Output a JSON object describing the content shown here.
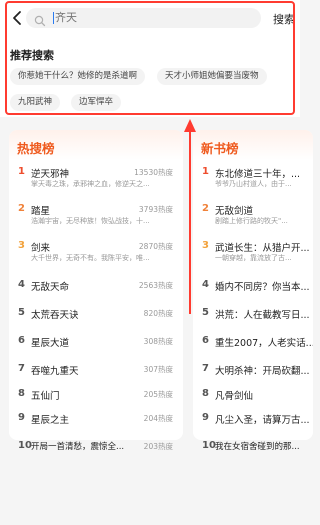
{
  "search": {
    "placeholder": "齐天",
    "search_button": "搜索"
  },
  "recommend": {
    "title": "推荐搜索",
    "tags": [
      "你惹她干什么？她修的是杀道啊",
      "天才小师姐她偏要当废物",
      "九阳武神",
      "边军悍卒"
    ]
  },
  "hot_list": {
    "title": "热搜榜",
    "items": [
      {
        "rank": "1",
        "title": "逆天邪神",
        "metric": "13530热度",
        "sub": "掌天毒之珠，承邪神之血，修逆天之..."
      },
      {
        "rank": "2",
        "title": "踏星",
        "metric": "3793热度",
        "sub": "浩瀚宇宙，无尽种族！恢弘战技，十..."
      },
      {
        "rank": "3",
        "title": "剑来",
        "metric": "2870热度",
        "sub": "大千世界，无奇不有。我陈平安，唯..."
      },
      {
        "rank": "4",
        "title": "无敌天命",
        "metric": "2563热度",
        "sub": ""
      },
      {
        "rank": "5",
        "title": "太荒吞天诀",
        "metric": "820热度",
        "sub": ""
      },
      {
        "rank": "6",
        "title": "星辰大道",
        "metric": "308热度",
        "sub": ""
      },
      {
        "rank": "7",
        "title": "吞噬九重天",
        "metric": "307热度",
        "sub": ""
      },
      {
        "rank": "8",
        "title": "五仙门",
        "metric": "205热度",
        "sub": ""
      },
      {
        "rank": "9",
        "title": "星辰之主",
        "metric": "204热度",
        "sub": ""
      },
      {
        "rank": "10",
        "title": "开局一首清愁，震惊全...",
        "metric": "203热度",
        "sub": ""
      }
    ]
  },
  "new_list": {
    "title": "新书榜",
    "items": [
      {
        "rank": "1",
        "title": "东北修道三十年，...",
        "sub": "爷爷乃山村道人，由于..."
      },
      {
        "rank": "2",
        "title": "无敌剑道",
        "sub": "剧踏上修行路的牧天\"..."
      },
      {
        "rank": "3",
        "title": "武道长生：从猎户开...",
        "sub": "一朝穿越，靠流放了古..."
      },
      {
        "rank": "4",
        "title": "婚内不同房？你当本...",
        "sub": ""
      },
      {
        "rank": "5",
        "title": "洪荒：人在截教写日...",
        "sub": ""
      },
      {
        "rank": "6",
        "title": "重生2007，人老实话...",
        "sub": ""
      },
      {
        "rank": "7",
        "title": "大明杀神：开局砍翻...",
        "sub": ""
      },
      {
        "rank": "8",
        "title": "凡骨剑仙",
        "sub": ""
      },
      {
        "rank": "9",
        "title": "凡尘入圣，请算万古...",
        "sub": ""
      },
      {
        "rank": "10",
        "title": "我在女宿舍碰到的那...",
        "sub": ""
      }
    ]
  },
  "colors": {
    "accent_orange": "#ef5a1e",
    "annotation_red": "#ff3b30",
    "caret_blue": "#2a7bf0"
  }
}
